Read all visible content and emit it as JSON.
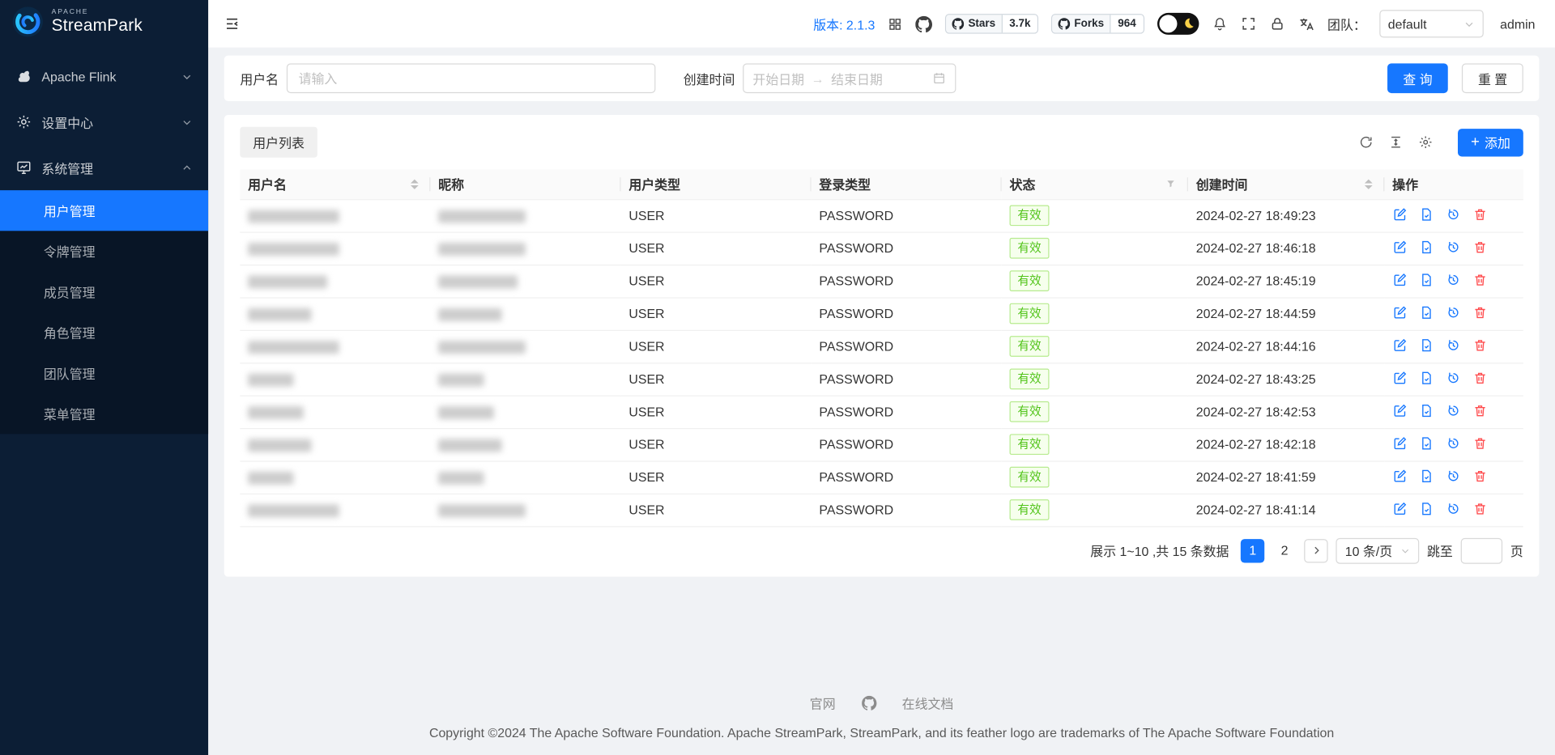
{
  "brand": {
    "top": "APACHE",
    "name": "StreamPark"
  },
  "sidebar": {
    "items": [
      {
        "label": "Apache Flink",
        "icon": "flink-icon",
        "chevron": "down"
      },
      {
        "label": "设置中心",
        "icon": "gear-icon",
        "chevron": "down"
      },
      {
        "label": "系统管理",
        "icon": "monitor-icon",
        "chevron": "up"
      }
    ],
    "sub_items": [
      "用户管理",
      "令牌管理",
      "成员管理",
      "角色管理",
      "团队管理",
      "菜单管理"
    ],
    "active_sub_item": "用户管理"
  },
  "header": {
    "version": "版本: 2.1.3",
    "github_stars": {
      "label": "Stars",
      "count": "3.7k"
    },
    "github_forks": {
      "label": "Forks",
      "count": "964"
    },
    "team_label": "团队：",
    "team_value": "default",
    "username": "admin"
  },
  "filters": {
    "username_label": "用户名",
    "username_placeholder": "请输入",
    "created_time_label": "创建时间",
    "date_start_placeholder": "开始日期",
    "date_end_placeholder": "结束日期",
    "date_separator": "→",
    "search_button": "查 询",
    "reset_button": "重 置"
  },
  "table": {
    "tab_label": "用户列表",
    "add_button": "添加",
    "columns": [
      "用户名",
      "昵称",
      "用户类型",
      "登录类型",
      "状态",
      "创建时间",
      "操作"
    ],
    "rows": [
      {
        "user_type": "USER",
        "login_type": "PASSWORD",
        "status": "有效",
        "create_time": "2024-02-27 18:49:23",
        "redact": [
          92,
          88
        ]
      },
      {
        "user_type": "USER",
        "login_type": "PASSWORD",
        "status": "有效",
        "create_time": "2024-02-27 18:46:18",
        "redact": [
          92,
          88
        ]
      },
      {
        "user_type": "USER",
        "login_type": "PASSWORD",
        "status": "有效",
        "create_time": "2024-02-27 18:45:19",
        "redact": [
          80,
          80
        ]
      },
      {
        "user_type": "USER",
        "login_type": "PASSWORD",
        "status": "有效",
        "create_time": "2024-02-27 18:44:59",
        "redact": [
          64,
          64
        ]
      },
      {
        "user_type": "USER",
        "login_type": "PASSWORD",
        "status": "有效",
        "create_time": "2024-02-27 18:44:16",
        "redact": [
          92,
          88
        ]
      },
      {
        "user_type": "USER",
        "login_type": "PASSWORD",
        "status": "有效",
        "create_time": "2024-02-27 18:43:25",
        "redact": [
          46,
          46
        ]
      },
      {
        "user_type": "USER",
        "login_type": "PASSWORD",
        "status": "有效",
        "create_time": "2024-02-27 18:42:53",
        "redact": [
          56,
          56
        ]
      },
      {
        "user_type": "USER",
        "login_type": "PASSWORD",
        "status": "有效",
        "create_time": "2024-02-27 18:42:18",
        "redact": [
          64,
          64
        ]
      },
      {
        "user_type": "USER",
        "login_type": "PASSWORD",
        "status": "有效",
        "create_time": "2024-02-27 18:41:59",
        "redact": [
          46,
          46
        ]
      },
      {
        "user_type": "USER",
        "login_type": "PASSWORD",
        "status": "有效",
        "create_time": "2024-02-27 18:41:14",
        "redact": [
          92,
          88
        ]
      }
    ]
  },
  "pagination": {
    "summary": "展示 1~10 ,共 15 条数据",
    "pages": [
      "1",
      "2"
    ],
    "active_page": "1",
    "page_size": "10 条/页",
    "jump_label": "跳至",
    "jump_unit": "页"
  },
  "footer": {
    "link_site": "官网",
    "link_docs": "在线文档",
    "copyright": "Copyright ©2024 The Apache Software Foundation. Apache StreamPark, StreamPark, and its feather logo are trademarks of The Apache Software Foundation"
  },
  "colors": {
    "primary": "#1677ff",
    "sidebar_bg": "#0c1e35",
    "submenu_bg": "#081526",
    "status_green": "#52c41a",
    "danger": "#ff4d4f"
  }
}
